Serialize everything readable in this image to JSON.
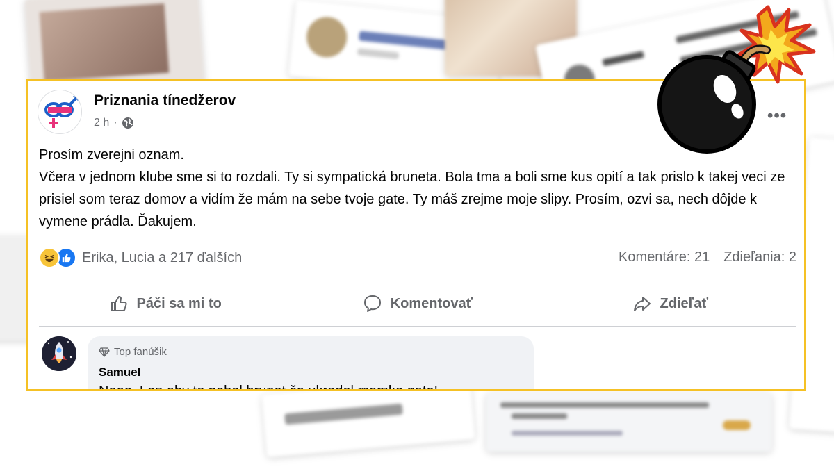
{
  "post": {
    "page_name": "Priznania tínedžerov",
    "time": "2 h",
    "separator": "·",
    "more": "•••",
    "body_lines": [
      "Prosím zverejni oznam.",
      "Včera v jednom klube sme si to rozdali. Ty si sympatická bruneta. Bola tma a boli sme kus opití a tak prislo k takej veci ze prisiel som teraz domov a vidím že mám na sebe tvoje gate. Ty máš zrejme moje slipy. Prosím, ozvi sa, nech dôjde k vymene prádla. Ďakujem."
    ],
    "reactions_text": "Erika, Lucia a 217 ďalších",
    "comments_count": "Komentáre: 21",
    "shares_count": "Zdieľania: 2",
    "actions": {
      "like": "Páči sa mi to",
      "comment": "Komentovať",
      "share": "Zdieľať"
    },
    "top_comment": {
      "badge": "Top fanúšik",
      "author": "Samuel",
      "text": "Nooo. Len aby to nebol brunet čo ukradol mamke gate!"
    }
  },
  "colors": {
    "highlight_border": "#f5c125",
    "facebook_blue": "#1877f2",
    "secondary_text": "#65676b"
  },
  "icons": [
    "globe-icon",
    "haha-reaction-icon",
    "like-reaction-icon",
    "thumbs-up-icon",
    "comment-icon",
    "share-icon",
    "diamond-icon",
    "bomb-icon"
  ]
}
